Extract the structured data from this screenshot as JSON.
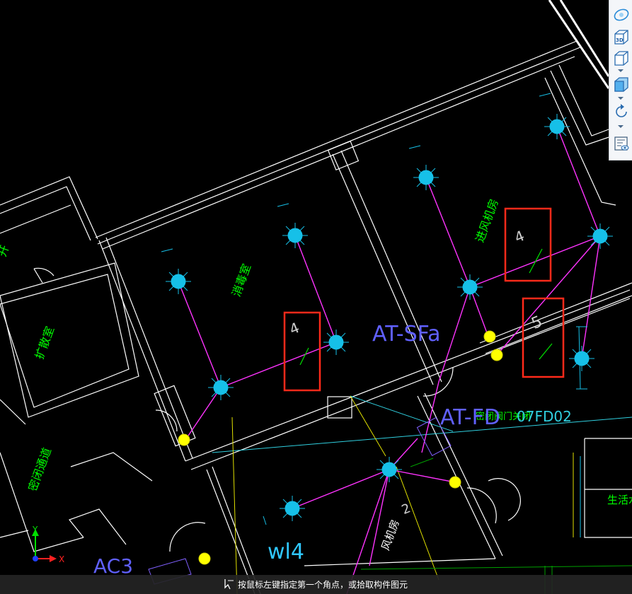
{
  "viewport": {
    "background": "#000000",
    "room_labels": [
      {
        "id": "left-edge",
        "text": "开"
      },
      {
        "id": "disinfection",
        "text": "消毒室"
      },
      {
        "id": "fresh-air",
        "text": "进风机房"
      },
      {
        "id": "storage",
        "text": "扩散室"
      },
      {
        "id": "sealed-passage",
        "text": "密闭通道"
      },
      {
        "id": "fan-room",
        "text": "风机房"
      },
      {
        "id": "domestic-water",
        "text": "生活水"
      },
      {
        "id": "overlap",
        "text": "密闭阀门关闭"
      }
    ],
    "tags": {
      "at_sfa": "AT-SFa",
      "at_fd": "AT-FD",
      "fd_code": "07FD02",
      "wl4": "wl4",
      "ac3": "AC3",
      "glyph_1": "4",
      "glyph_2": "4",
      "glyph_3": "5",
      "glyph_4": "2"
    },
    "colors": {
      "walls": "#ffffff",
      "room_label": "#00ff00",
      "pipe": "#ff33ff",
      "sprinkler": "#16c0e8",
      "valve": "#ffff00",
      "highlight": "#ff2a1a",
      "tag": "#6060ff",
      "cyan_line": "#30d0e0"
    }
  },
  "axis": {
    "x_label": "X",
    "y_label": "Y"
  },
  "toolbar": {
    "buttons": [
      {
        "name": "orbit-icon"
      },
      {
        "name": "view-3d-icon",
        "label": "3D"
      },
      {
        "name": "view-box-icon"
      },
      {
        "name": "view-shaded-icon"
      },
      {
        "name": "rotate-icon"
      },
      {
        "name": "layer-properties-icon"
      }
    ]
  },
  "status_bar": {
    "prompt": "按鼠标左键指定第一个角点，或拾取构件图元"
  }
}
